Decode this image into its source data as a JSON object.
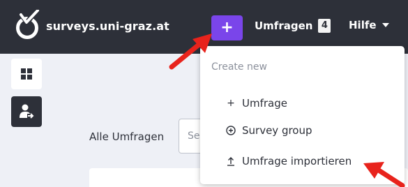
{
  "navbar": {
    "brand": "surveys.uni-graz.at",
    "add_label": "+",
    "surveys_label": "Umfragen",
    "surveys_count": "4",
    "help_label": "Hilfe"
  },
  "main": {
    "all_surveys_label": "Alle Umfragen",
    "search_placeholder": "Se"
  },
  "dropdown": {
    "header": "Create new",
    "items": [
      {
        "icon": "plus-icon",
        "label": "Umfrage"
      },
      {
        "icon": "circle-plus-icon",
        "label": "Survey group"
      },
      {
        "icon": "upload-icon",
        "label": "Umfrage importieren"
      }
    ]
  },
  "colors": {
    "navbar": "#2d3039",
    "accent": "#7a45ea",
    "arrow": "#e8231c"
  }
}
